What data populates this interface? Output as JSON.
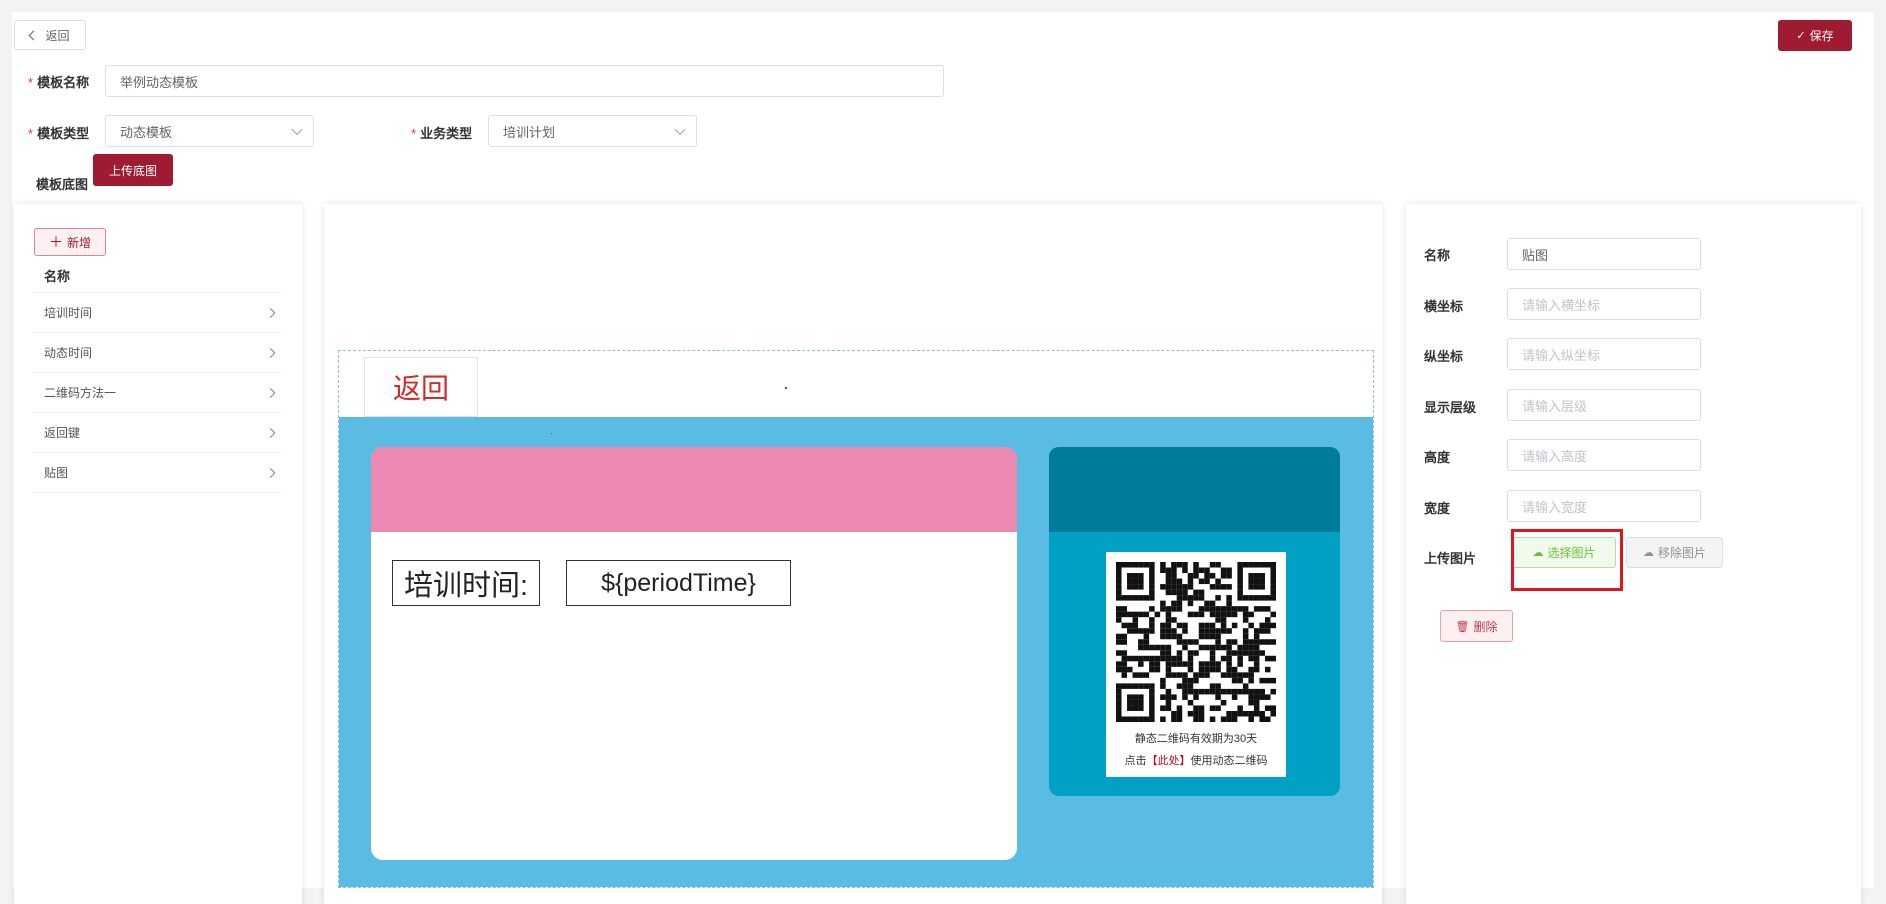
{
  "header": {
    "back_label": "返回",
    "save_label": "保存"
  },
  "form": {
    "name_label": "模板名称",
    "name_value": "举例动态模板",
    "type_label": "模板类型",
    "type_value": "动态模板",
    "biz_label": "业务类型",
    "biz_value": "培训计划",
    "bg_label": "模板底图",
    "upload_bg_label": "上传底图"
  },
  "left_panel": {
    "add_label": "新增",
    "column_header": "名称",
    "items": [
      {
        "label": "培训时间"
      },
      {
        "label": "动态时间"
      },
      {
        "label": "二维码方法一"
      },
      {
        "label": "返回键"
      },
      {
        "label": "贴图"
      }
    ]
  },
  "canvas": {
    "back_text": "返回",
    "field_label": "培训时间:",
    "field_value": "${periodTime}",
    "qr_line1": "静态二维码有效期为30天",
    "qr_line2_prefix": "点击",
    "qr_line2_link": "【此处】",
    "qr_line2_suffix": "使用动态二维码"
  },
  "right_panel": {
    "name_label": "名称",
    "name_value": "贴图",
    "x_label": "横坐标",
    "x_placeholder": "请输入横坐标",
    "y_label": "纵坐标",
    "y_placeholder": "请输入纵坐标",
    "z_label": "显示层级",
    "z_placeholder": "请输入层级",
    "h_label": "高度",
    "h_placeholder": "请输入高度",
    "w_label": "宽度",
    "w_placeholder": "请输入宽度",
    "upload_label": "上传图片",
    "select_image_label": "选择图片",
    "remove_image_label": "移除图片",
    "delete_label": "删除"
  },
  "colors": {
    "brand": "#9e1b32",
    "canvas_bg": "#5bbce3",
    "card_header_pink": "#eb89b3",
    "qr_card_top": "#007c9b",
    "qr_card_body": "#03a0c6",
    "highlight": "#e0161e"
  },
  "icons": {
    "back": "chevron-left-icon",
    "save": "check-icon",
    "add": "plus-icon",
    "list_item": "chevron-right-icon",
    "select_image": "cloud-upload-icon",
    "remove_image": "cloud-icon",
    "delete": "trash-icon"
  }
}
